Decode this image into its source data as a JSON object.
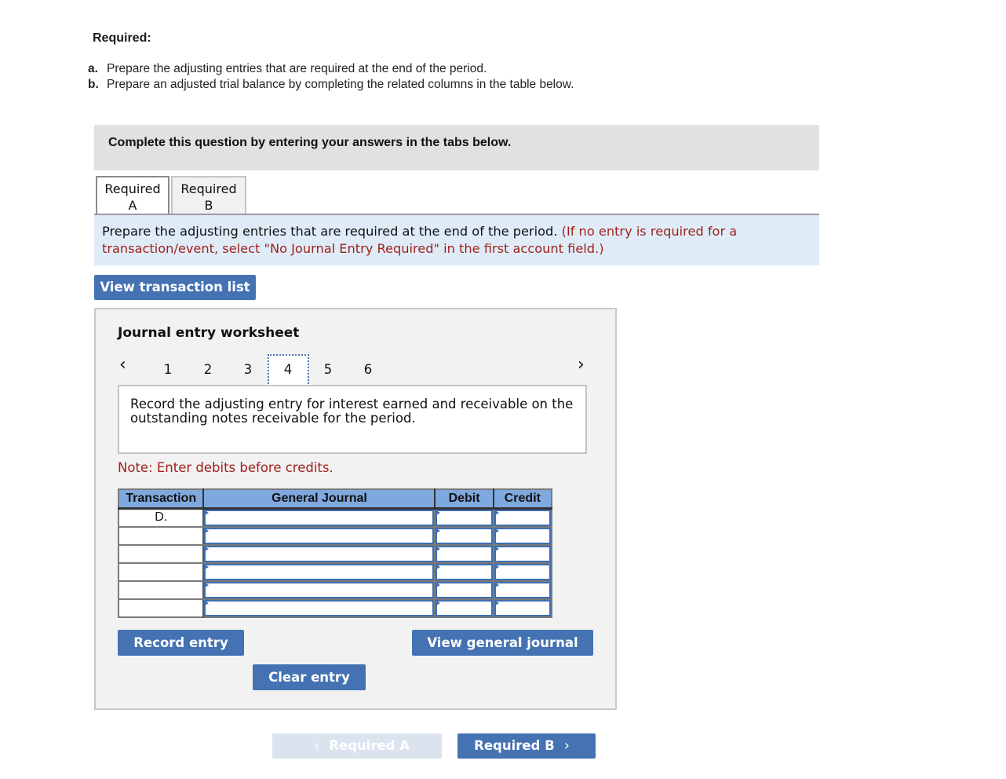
{
  "required": {
    "heading": "Required:",
    "items": [
      {
        "letter": "a.",
        "text": "Prepare the adjusting entries that are required at the end of the period."
      },
      {
        "letter": "b.",
        "text": "Prepare an adjusted trial balance by completing the related columns in the table below."
      }
    ]
  },
  "banner": "Complete this question by entering your answers in the tabs below.",
  "tabs": [
    {
      "line1": "Required",
      "line2": "A",
      "active": true
    },
    {
      "line1": "Required",
      "line2": "B",
      "active": false
    }
  ],
  "instruction": {
    "text": "Prepare the adjusting entries that are required at the end of the period.",
    "hint": "(If no entry is required for a transaction/event, select \"No Journal Entry Required\" in the first account field.)"
  },
  "view_transaction_list": "View transaction list",
  "worksheet": {
    "title": "Journal entry worksheet",
    "prev_icon": "‹",
    "next_icon": "›",
    "pages": [
      "1",
      "2",
      "3",
      "4",
      "5",
      "6"
    ],
    "active_page": "4",
    "description": "Record the adjusting entry for interest earned and receivable on the outstanding notes receivable for the period.",
    "note": "Note: Enter debits before credits.",
    "table": {
      "headers": [
        "Transaction",
        "General Journal",
        "Debit",
        "Credit"
      ],
      "rows": [
        {
          "transaction": "D.",
          "account": "",
          "debit": "",
          "credit": ""
        },
        {
          "transaction": "",
          "account": "",
          "debit": "",
          "credit": ""
        },
        {
          "transaction": "",
          "account": "",
          "debit": "",
          "credit": ""
        },
        {
          "transaction": "",
          "account": "",
          "debit": "",
          "credit": ""
        },
        {
          "transaction": "",
          "account": "",
          "debit": "",
          "credit": ""
        },
        {
          "transaction": "",
          "account": "",
          "debit": "",
          "credit": ""
        }
      ]
    },
    "buttons": {
      "record": "Record entry",
      "clear": "Clear entry",
      "view_general_journal": "View general journal"
    }
  },
  "navigation": {
    "prev_label": "Required A",
    "prev_icon": "‹",
    "next_label": "Required B",
    "next_icon": "›"
  },
  "colors": {
    "button_blue": "#4472b3",
    "header_blue": "#7fa8de",
    "hint_red": "#a0211b",
    "instruction_bg": "#dfecf8"
  }
}
